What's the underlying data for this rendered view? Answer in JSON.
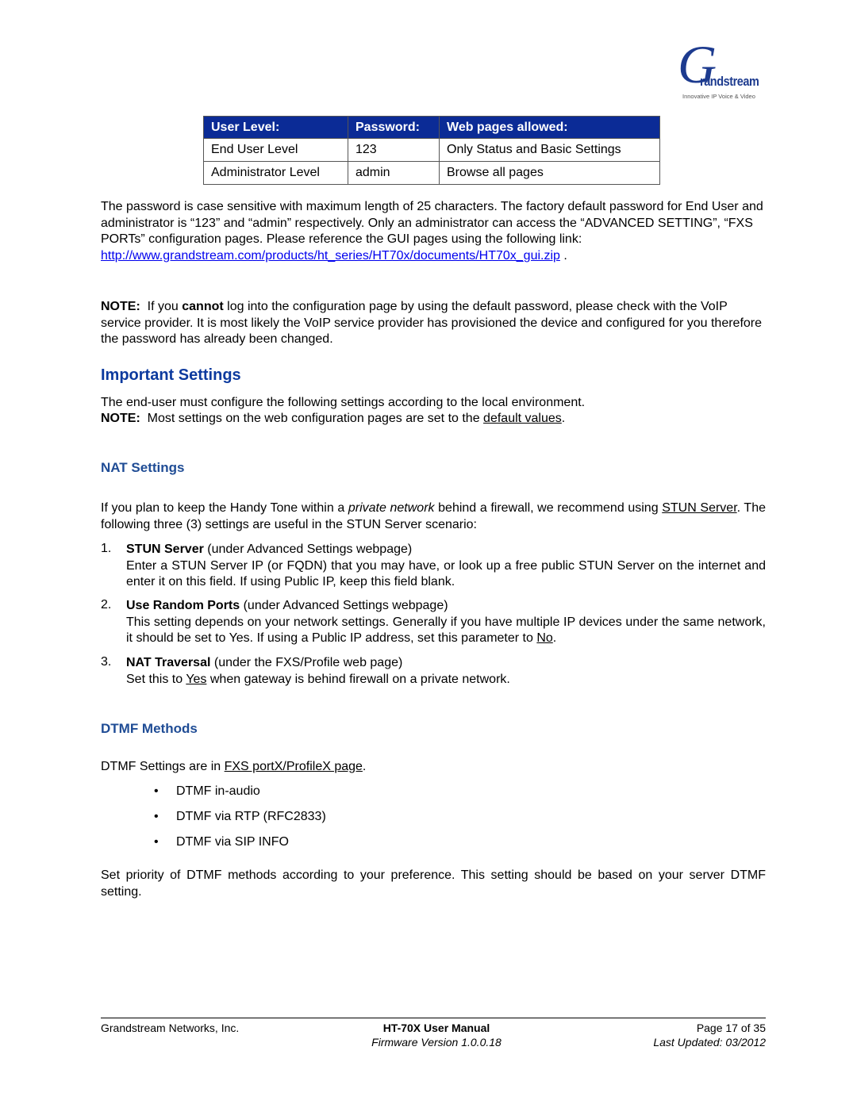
{
  "logo": {
    "initial": "G",
    "name": "randstream",
    "tagline": "Innovative IP Voice & Video",
    "brand_color": "#1d3b8f"
  },
  "user_table": {
    "header_color": "#0b2b96",
    "headers": [
      "User Level:",
      "Password:",
      "Web pages allowed:"
    ],
    "rows": [
      [
        "End User Level",
        "123",
        "Only Status and Basic Settings"
      ],
      [
        "Administrator Level",
        "admin",
        "Browse all pages"
      ]
    ]
  },
  "password_paragraph": {
    "text": "The password is case sensitive with maximum length of 25 characters. The factory default password for End User and administrator is “123” and “admin” respectively. Only an administrator can access the “ADVANCED SETTING”, “FXS PORTs” configuration pages.  Please reference the GUI pages using the following link:",
    "link": "http://www.grandstream.com/products/ht_series/HT70x/documents/HT70x_gui.zip",
    "suffix": " ."
  },
  "note1": {
    "label": "NOTE:",
    "pre": "  If you ",
    "bold": "cannot",
    "post": " log into the configuration page by using the default password, please check with the VoIP service provider.  It is most likely the VoIP service provider has provisioned the device and configured for you therefore the password has already been changed."
  },
  "important": {
    "heading": "Important Settings",
    "heading_color": "#0c3a9e",
    "line1": "The end-user must configure the following settings according to the local environment.",
    "note_label": "NOTE:",
    "note_text": "  Most settings on the web configuration pages are set to the ",
    "note_link": "default values",
    "note_end": "."
  },
  "nat": {
    "heading": "NAT Settings",
    "heading_color": "#1f4c95",
    "intro_pre": "If you plan to keep the Handy Tone within a ",
    "intro_italic": "private network",
    "intro_mid": " behind a firewall, we recommend using ",
    "intro_link": "STUN Server",
    "intro_post": ". The following three (3) settings are useful in the STUN Server scenario:",
    "items": [
      {
        "num": "1.",
        "title": "STUN Server",
        "context": " (under Advanced Settings webpage)",
        "body": "Enter a STUN Server IP (or FQDN) that you may have, or look up a free public STUN Server on the internet and enter it on this field. If using Public IP, keep this field blank."
      },
      {
        "num": "2.",
        "title": "Use Random Ports",
        "context": " (under Advanced Settings webpage)",
        "body": "This setting depends on your network settings.  Generally if you have multiple IP devices under the same network, it should be set to Yes. If using a Public IP address, set this parameter to ",
        "body_link": "No",
        "body_end": "."
      },
      {
        "num": "3.",
        "title": "NAT Traversal",
        "context": " (under the FXS/Profile web page)",
        "body_pre": "Set this to ",
        "body_link": "Yes",
        "body": " when gateway is behind firewall on a private network."
      }
    ]
  },
  "dtmf": {
    "heading": "DTMF Methods",
    "intro_pre": "DTMF Settings are in ",
    "intro_link": "FXS portX/ProfileX page",
    "intro_end": ".",
    "bullet_glyph": "•",
    "bullets": [
      "DTMF in-audio",
      "DTMF via RTP (RFC2833)",
      "DTMF via SIP INFO"
    ],
    "closing": "Set priority of DTMF methods according to your preference. This setting should be based on your server DTMF setting."
  },
  "footer": {
    "company": "Grandstream Networks, Inc.",
    "manual": "HT-70X User Manual",
    "firmware": "Firmware Version 1.0.0.18",
    "page": "Page 17 of 35",
    "updated": "Last Updated: 03/2012"
  }
}
